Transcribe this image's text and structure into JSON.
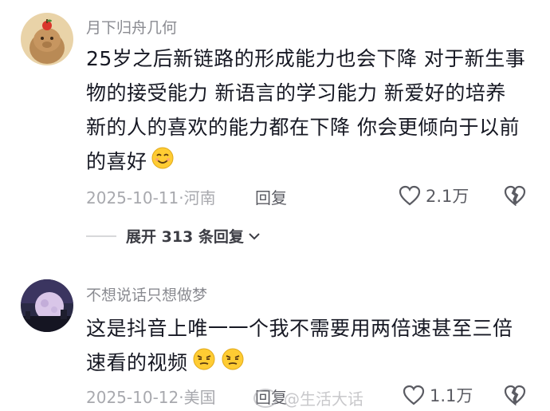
{
  "comments": [
    {
      "username": "月下归舟几何",
      "text": "25岁之后新链路的形成能力也会下降 对于新生事物的接受能力 新语言的学习能力 新爱好的培养 新的人的喜欢的能力都在下降 你会更倾向于以前的喜好",
      "emoji": "smile-emoji",
      "date_location": "2025-10-11·河南",
      "reply_label": "回复",
      "likes": "2.1万",
      "expand_label": "展开 313 条回复"
    },
    {
      "username": "不想说话只想做梦",
      "text": "这是抖音上唯一一个我不需要用两倍速甚至三倍速看的视频",
      "emoji": "squint-emoji",
      "date_location": "2025-10-12·美国",
      "reply_label": "回复",
      "likes": "1.1万"
    }
  ],
  "watermark": "@生活大话",
  "colors": {
    "text": "#161823",
    "meta": "#a8a9ae",
    "username": "#8a8b91"
  }
}
